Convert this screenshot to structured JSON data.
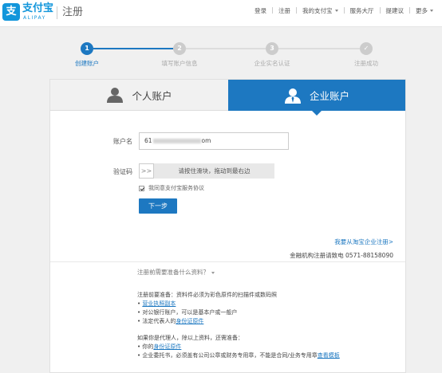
{
  "header": {
    "logo_cn": "支付宝",
    "logo_en": "ALIPAY",
    "logo_mark": "支",
    "page_title": "注册",
    "nav": [
      "登录",
      "注册",
      "我的支付宝",
      "服务大厅",
      "提建议",
      "更多"
    ]
  },
  "steps": [
    {
      "num": "1",
      "label": "创建账户",
      "state": "active"
    },
    {
      "num": "2",
      "label": "填写账户信息",
      "state": "todo"
    },
    {
      "num": "3",
      "label": "企业实名认证",
      "state": "todo"
    },
    {
      "num": "✓",
      "label": "注册成功",
      "state": "todo"
    }
  ],
  "tabs": {
    "personal": "个人账户",
    "enterprise": "企业账户"
  },
  "form": {
    "account_label": "账户名",
    "account_prefix": "61",
    "account_suffix": "om",
    "captcha_label": "验证码",
    "slider_handle": ">>",
    "slider_text": "请按住滑块，拖动到最右边",
    "agree_text": "我同意支付宝服务协议",
    "next_button": "下一步"
  },
  "footer": {
    "link_right": "我要从淘宝企业注册>",
    "phone_line": "金融机构注册请致电 0571-88158090",
    "prep_toggle": "注册前需要准备什么资料？",
    "docs_intro": "注册前要准备：",
    "docs_intro_note": "资料件必须为彩色原件的扫描件或数码照",
    "doc_items": [
      {
        "prefix": "• ",
        "text": "营业执照副本",
        "link": true
      },
      {
        "prefix": "• ",
        "text": "对公银行账户，可以是基本户或一般户",
        "link": false
      },
      {
        "prefix": "• ",
        "text": "法定代表人的",
        "link": false,
        "tail_link": "身份证原件"
      }
    ],
    "agent_intro": "如果你是代理人，除以上资料，还需准备：",
    "agent_items": [
      {
        "prefix": "• ",
        "text": "你的",
        "tail_link": "身份证原件"
      },
      {
        "prefix": "• ",
        "text": "企业委托书，必须盖有公司公章或财务专用章，不能是合同/业务专用章",
        "tail_link": "查看模板"
      }
    ]
  },
  "colors": {
    "brand": "#1296db",
    "accent": "#1d78c1",
    "inactive": "#cccccc"
  }
}
